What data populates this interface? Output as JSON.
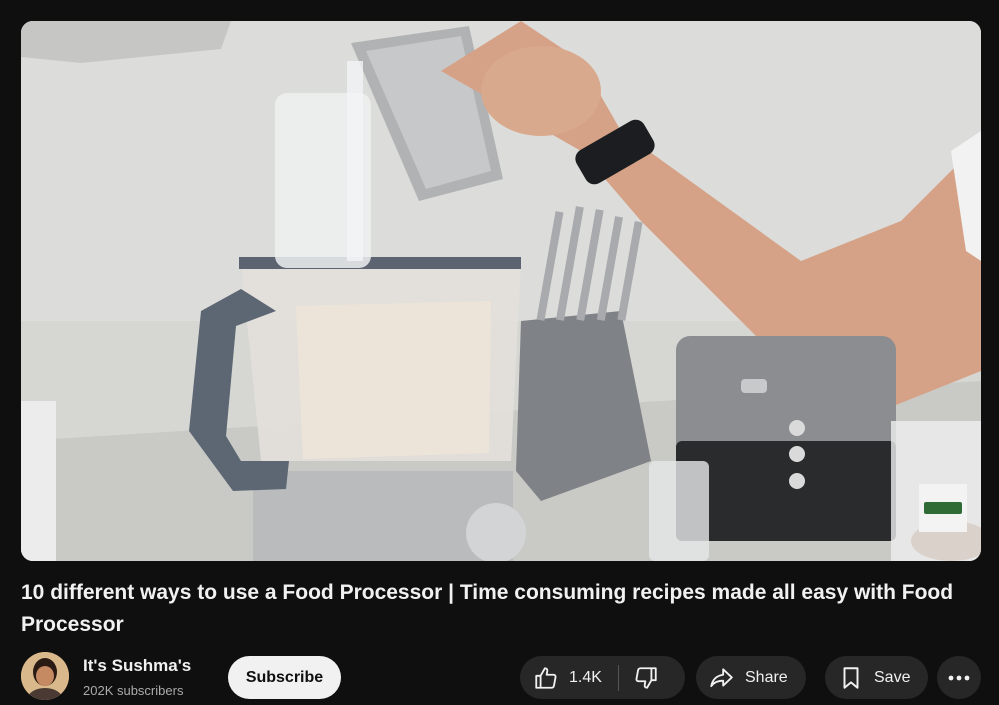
{
  "video": {
    "title": "10 different ways to use a Food Processor | Time consuming recipes made all easy with Food Processor"
  },
  "channel": {
    "name": "It's Sushma's",
    "subscribers": "202K subscribers"
  },
  "actions": {
    "subscribe_label": "Subscribe",
    "like_count": "1.4K",
    "share_label": "Share",
    "save_label": "Save"
  },
  "icons": {
    "like": "thumbs-up-icon",
    "dislike": "thumbs-down-icon",
    "share": "share-arrow-icon",
    "save": "bookmark-icon",
    "more": "more-horizontal-icon"
  },
  "colors": {
    "background": "#0f0f0f",
    "pill": "#272727",
    "subscribe_bg": "#f1f1f1",
    "text": "#f1f1f1",
    "muted": "#aaaaaa"
  }
}
